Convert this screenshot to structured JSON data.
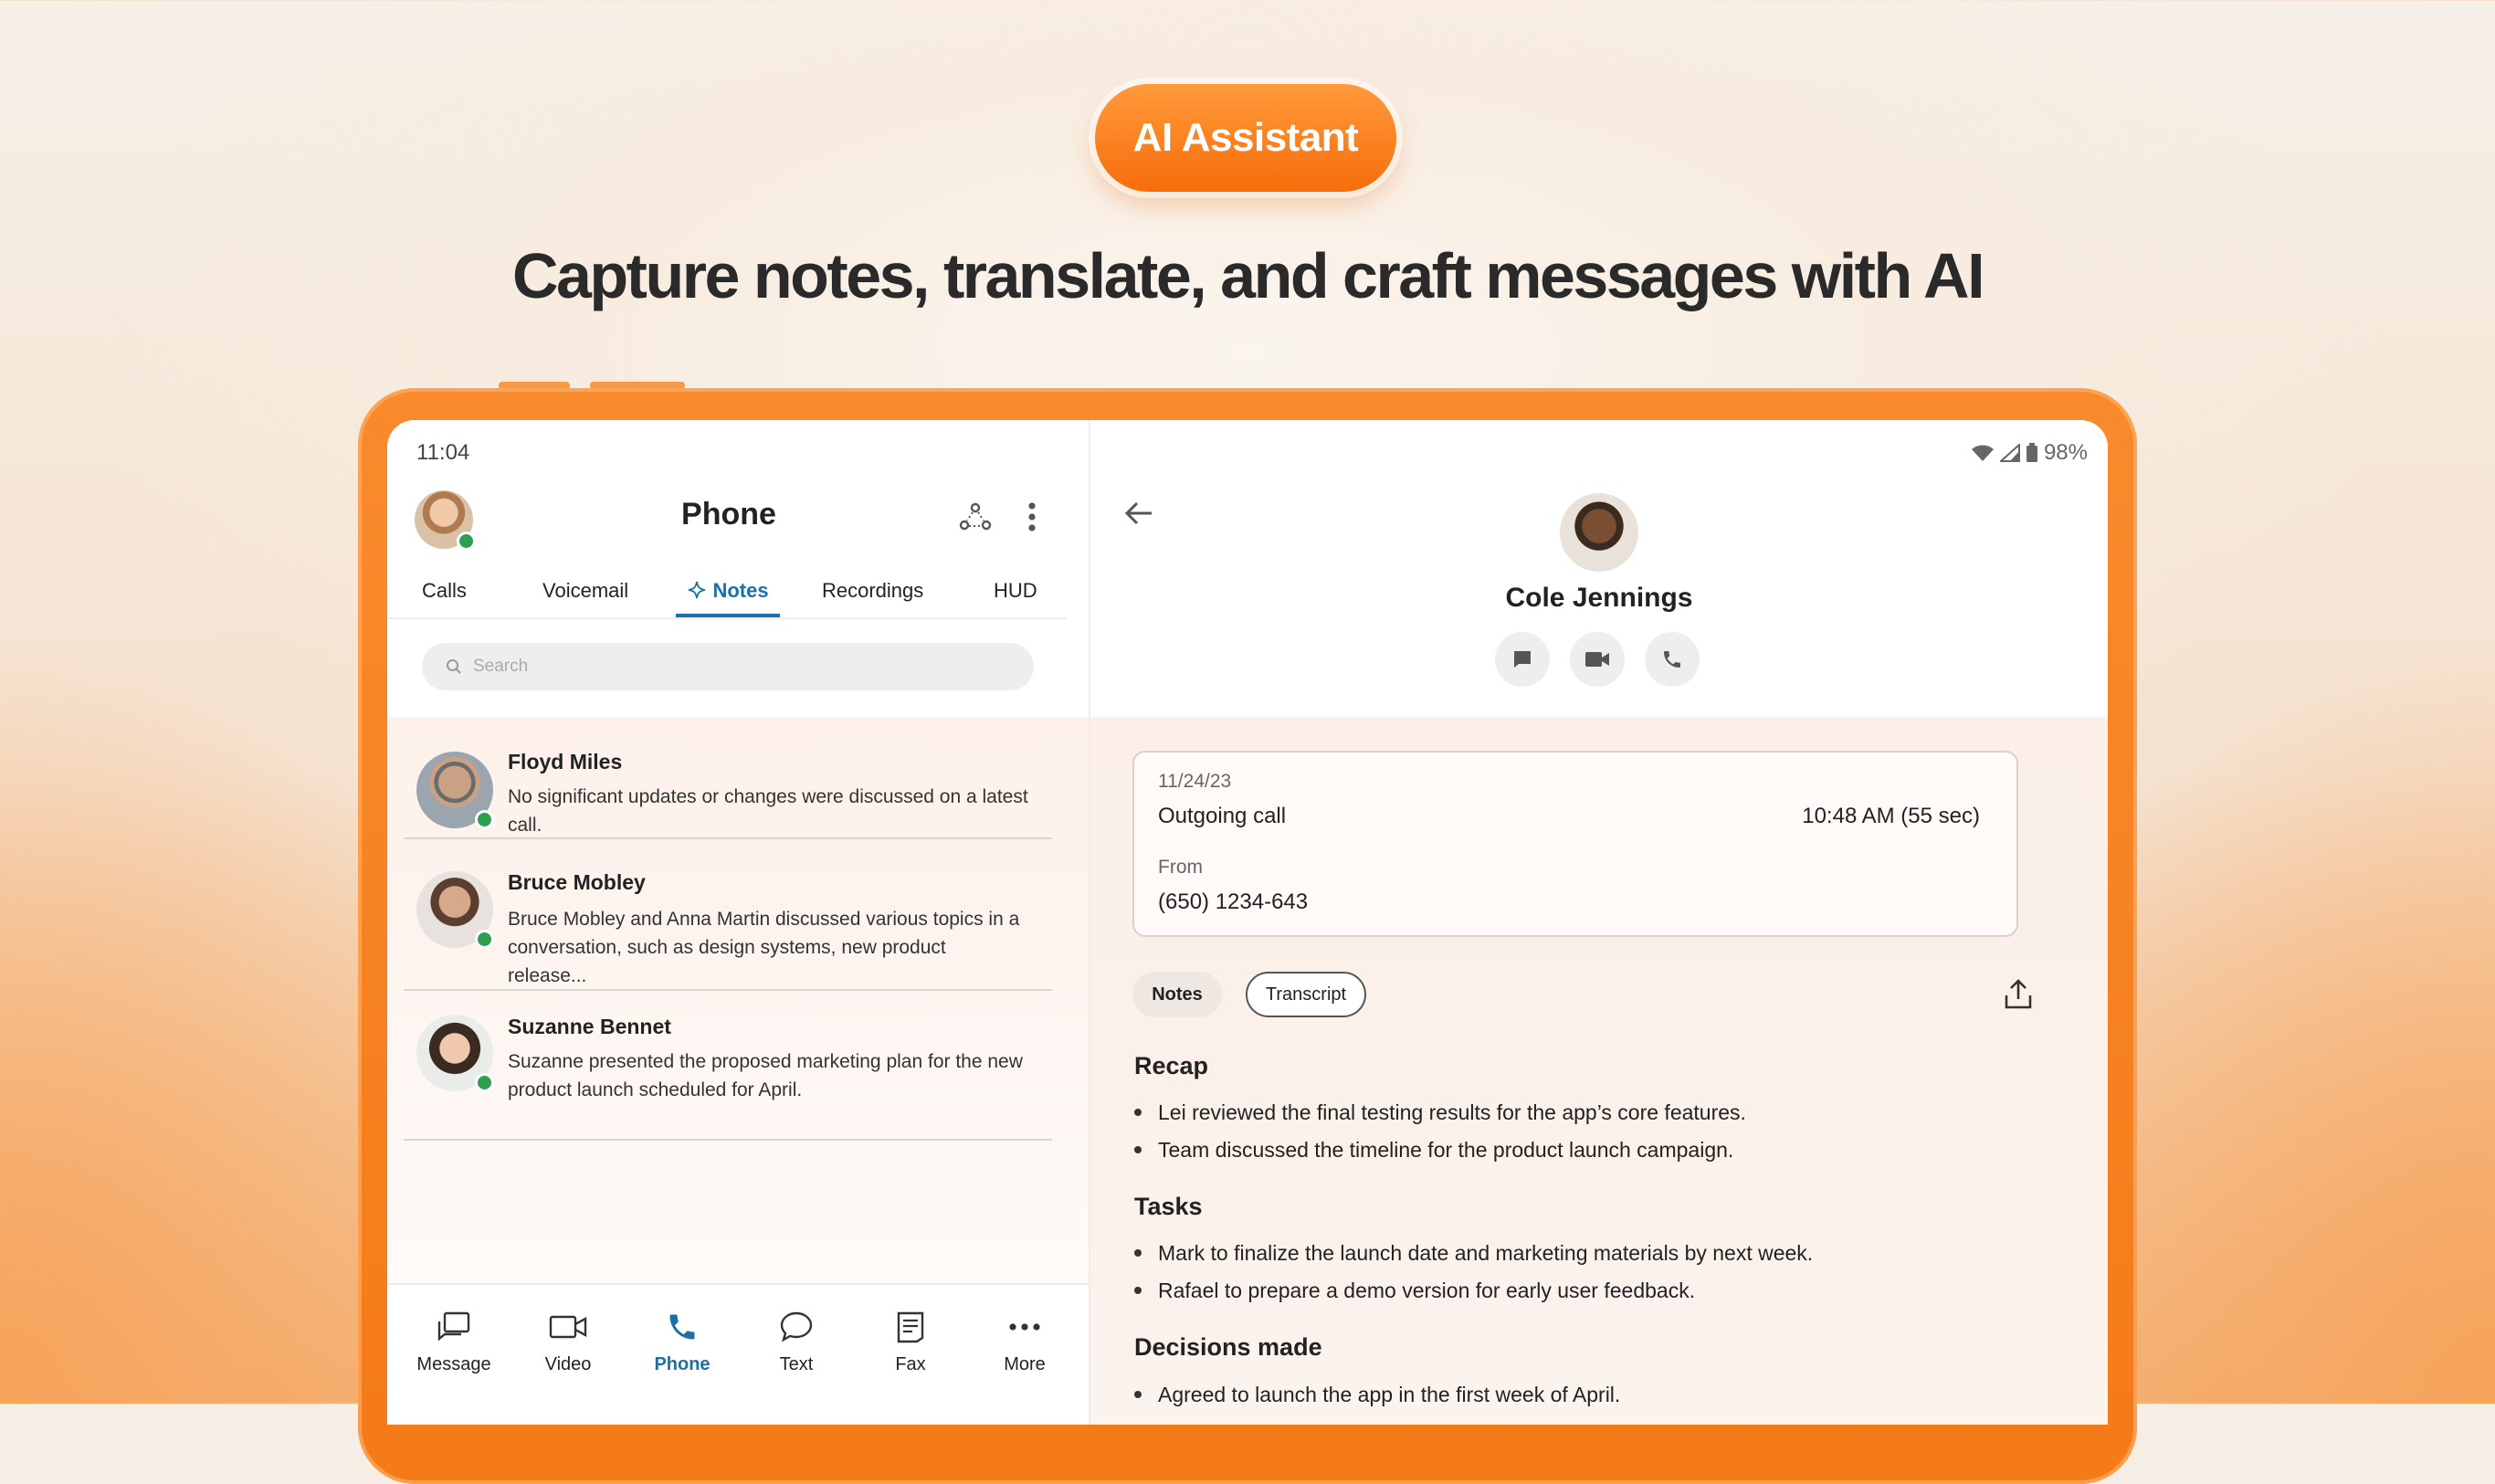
{
  "badge": "AI Assistant",
  "headline": "Capture notes, translate, and craft messages with AI",
  "device": {
    "time": "11:04",
    "battery": "98%"
  },
  "phone": {
    "title": "Phone",
    "tabs": [
      "Calls",
      "Voicemail",
      "Notes",
      "Recordings",
      "HUD"
    ],
    "search_placeholder": "Search",
    "notes": [
      {
        "name": "Floyd Miles",
        "text": "No significant updates or changes were discussed on a latest call."
      },
      {
        "name": "Bruce Mobley",
        "text": "Bruce Mobley and Anna Martin discussed various topics in a conversation, such as design systems, new product release..."
      },
      {
        "name": "Suzanne Bennet",
        "text": "Suzanne presented the proposed marketing plan for the new product launch scheduled for April."
      }
    ],
    "bottom_nav": [
      "Message",
      "Video",
      "Phone",
      "Text",
      "Fax",
      "More"
    ]
  },
  "contact": {
    "name": "Cole Jennings",
    "call": {
      "date": "11/24/23",
      "type": "Outgoing call",
      "time": "10:48 AM (55 sec)",
      "from_label": "From",
      "from_number": "(650) 1234-643"
    },
    "chips": [
      "Notes",
      "Transcript"
    ],
    "sections": {
      "recap_title": "Recap",
      "recap": [
        "Lei reviewed the final testing results for the app’s core features.",
        "Team discussed the timeline for the product launch campaign."
      ],
      "tasks_title": "Tasks",
      "tasks": [
        "Mark to finalize the launch date and marketing materials by next week.",
        "Rafael to prepare a demo version for early user feedback."
      ],
      "decisions_title": "Decisions made",
      "decisions": [
        "Agreed to launch the app in the first week of April."
      ]
    }
  },
  "colors": {
    "accent": "#1d6fa7",
    "brand_orange": "#f76d0c",
    "online": "#2e9e4f"
  }
}
